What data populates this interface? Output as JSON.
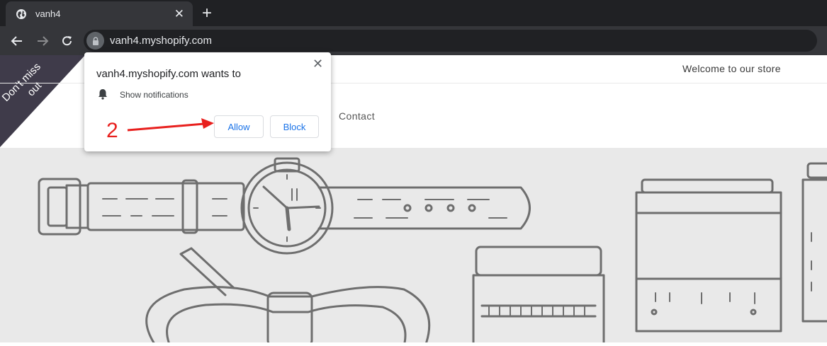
{
  "browser": {
    "tab_title": "vanh4",
    "url": "vanh4.myshopify.com"
  },
  "site": {
    "welcome": "Welcome to our store",
    "nav_contact": "Contact",
    "ribbon_line1": "Don't miss",
    "ribbon_line2": "out"
  },
  "permission_popup": {
    "title": "vanh4.myshopify.com wants to",
    "permission": "Show notifications",
    "allow_label": "Allow",
    "block_label": "Block"
  },
  "annotation": {
    "step_number": "2",
    "color": "#e8201e"
  },
  "icons": [
    "globe-icon",
    "close-icon",
    "plus-icon",
    "back-icon",
    "forward-icon",
    "reload-icon",
    "lock-icon",
    "bell-icon",
    "arrow-icon"
  ]
}
